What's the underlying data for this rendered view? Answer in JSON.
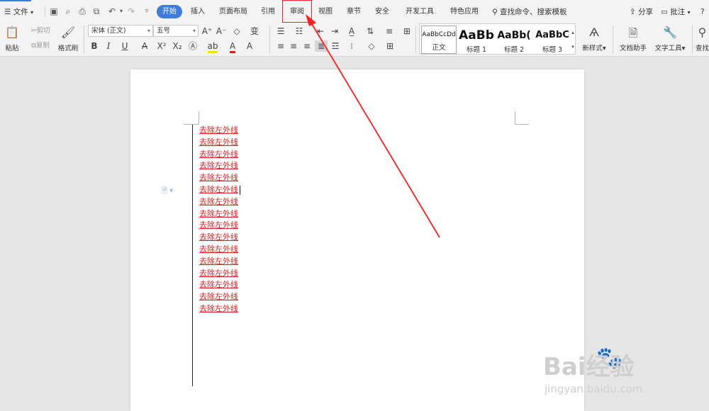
{
  "menubar": {
    "file_menu": "文件",
    "tabs": [
      {
        "label": "开始",
        "active": true
      },
      {
        "label": "插入"
      },
      {
        "label": "页面布局"
      },
      {
        "label": "引用"
      },
      {
        "label": "审阅",
        "highlighted": true
      },
      {
        "label": "视图"
      },
      {
        "label": "章节"
      },
      {
        "label": "安全"
      },
      {
        "label": "开发工具"
      },
      {
        "label": "特色应用"
      }
    ],
    "search_label": "查找命令、搜索模板",
    "share_label": "分享",
    "comment_label": "批注",
    "help_label": "?"
  },
  "ribbon": {
    "paste_label": "粘贴",
    "cut_label": "剪切",
    "copy_label": "复制",
    "format_painter_label": "格式刷",
    "font_name": "宋体 (正文)",
    "font_size": "五号",
    "styles": [
      {
        "sample": "AaBbCcDd",
        "label": "正文"
      },
      {
        "sample": "AaBb",
        "label": "标题 1"
      },
      {
        "sample": "AaBb(",
        "label": "标题 2"
      },
      {
        "sample": "AaBbC",
        "label": "标题 3"
      }
    ],
    "new_style_label": "新样式",
    "doc_assistant_label": "文档助手",
    "text_tools_label": "文字工具",
    "find_label": "查找"
  },
  "document": {
    "lines": [
      "去除左外线",
      "去除左外线",
      "去除左外线",
      "去除左外线",
      "去除左外线",
      "去除左外线",
      "去除左外线",
      "去除左外线",
      "去除左外线",
      "去除左外线",
      "去除左外线",
      "去除左外线",
      "去除左外线",
      "去除左外线",
      "去除左外线",
      "去除左外线"
    ],
    "text_color": "#e02020"
  },
  "annotation": {
    "highlight_color": "#ff1d1d",
    "target_tab": "审阅"
  },
  "watermark": {
    "brand": "Bai经验",
    "url": "jingyan.baidu.com"
  },
  "colors": {
    "accent": "#3f7bd9",
    "ribbon_bg": "#f3f3f3",
    "canvas_bg": "#e6e6e6"
  }
}
